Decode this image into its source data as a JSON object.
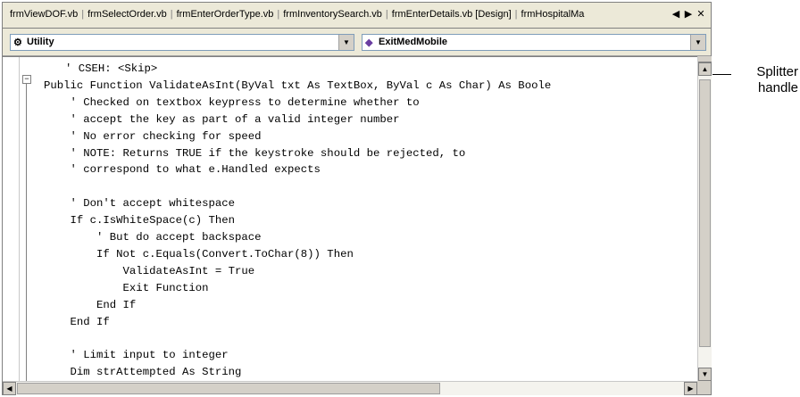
{
  "tabs": [
    "frmViewDOF.vb",
    "frmSelectOrder.vb",
    "frmEnterOrderType.vb",
    "frmInventorySearch.vb",
    "frmEnterDetails.vb [Design]",
    "frmHospitalMa"
  ],
  "tab_nav": {
    "prev": "◀",
    "next": "▶",
    "close": "✕"
  },
  "class_dropdown": {
    "value": "Utility",
    "icon": "utility-class-icon"
  },
  "method_dropdown": {
    "value": "ExitMedMobile",
    "icon": "method-icon"
  },
  "code_lines": [
    "' CSEH: <Skip>",
    "Public Function ValidateAsInt(ByVal txt As TextBox, ByVal c As Char) As Boole",
    "    ' Checked on textbox keypress to determine whether to",
    "    ' accept the key as part of a valid integer number",
    "    ' No error checking for speed",
    "    ' NOTE: Returns TRUE if the keystroke should be rejected, to",
    "    ' correspond to what e.Handled expects",
    "",
    "    ' Don't accept whitespace",
    "    If c.IsWhiteSpace(c) Then",
    "        ' But do accept backspace",
    "        If Not c.Equals(Convert.ToChar(8)) Then",
    "            ValidateAsInt = True",
    "            Exit Function",
    "        End If",
    "    End If",
    "",
    "    ' Limit input to integer",
    "    Dim strAttempted As String"
  ],
  "callout": {
    "label": "Splitter handle"
  },
  "colors": {
    "comment": "#000000",
    "keyword": "#000000",
    "panel": "#ece9d8"
  }
}
